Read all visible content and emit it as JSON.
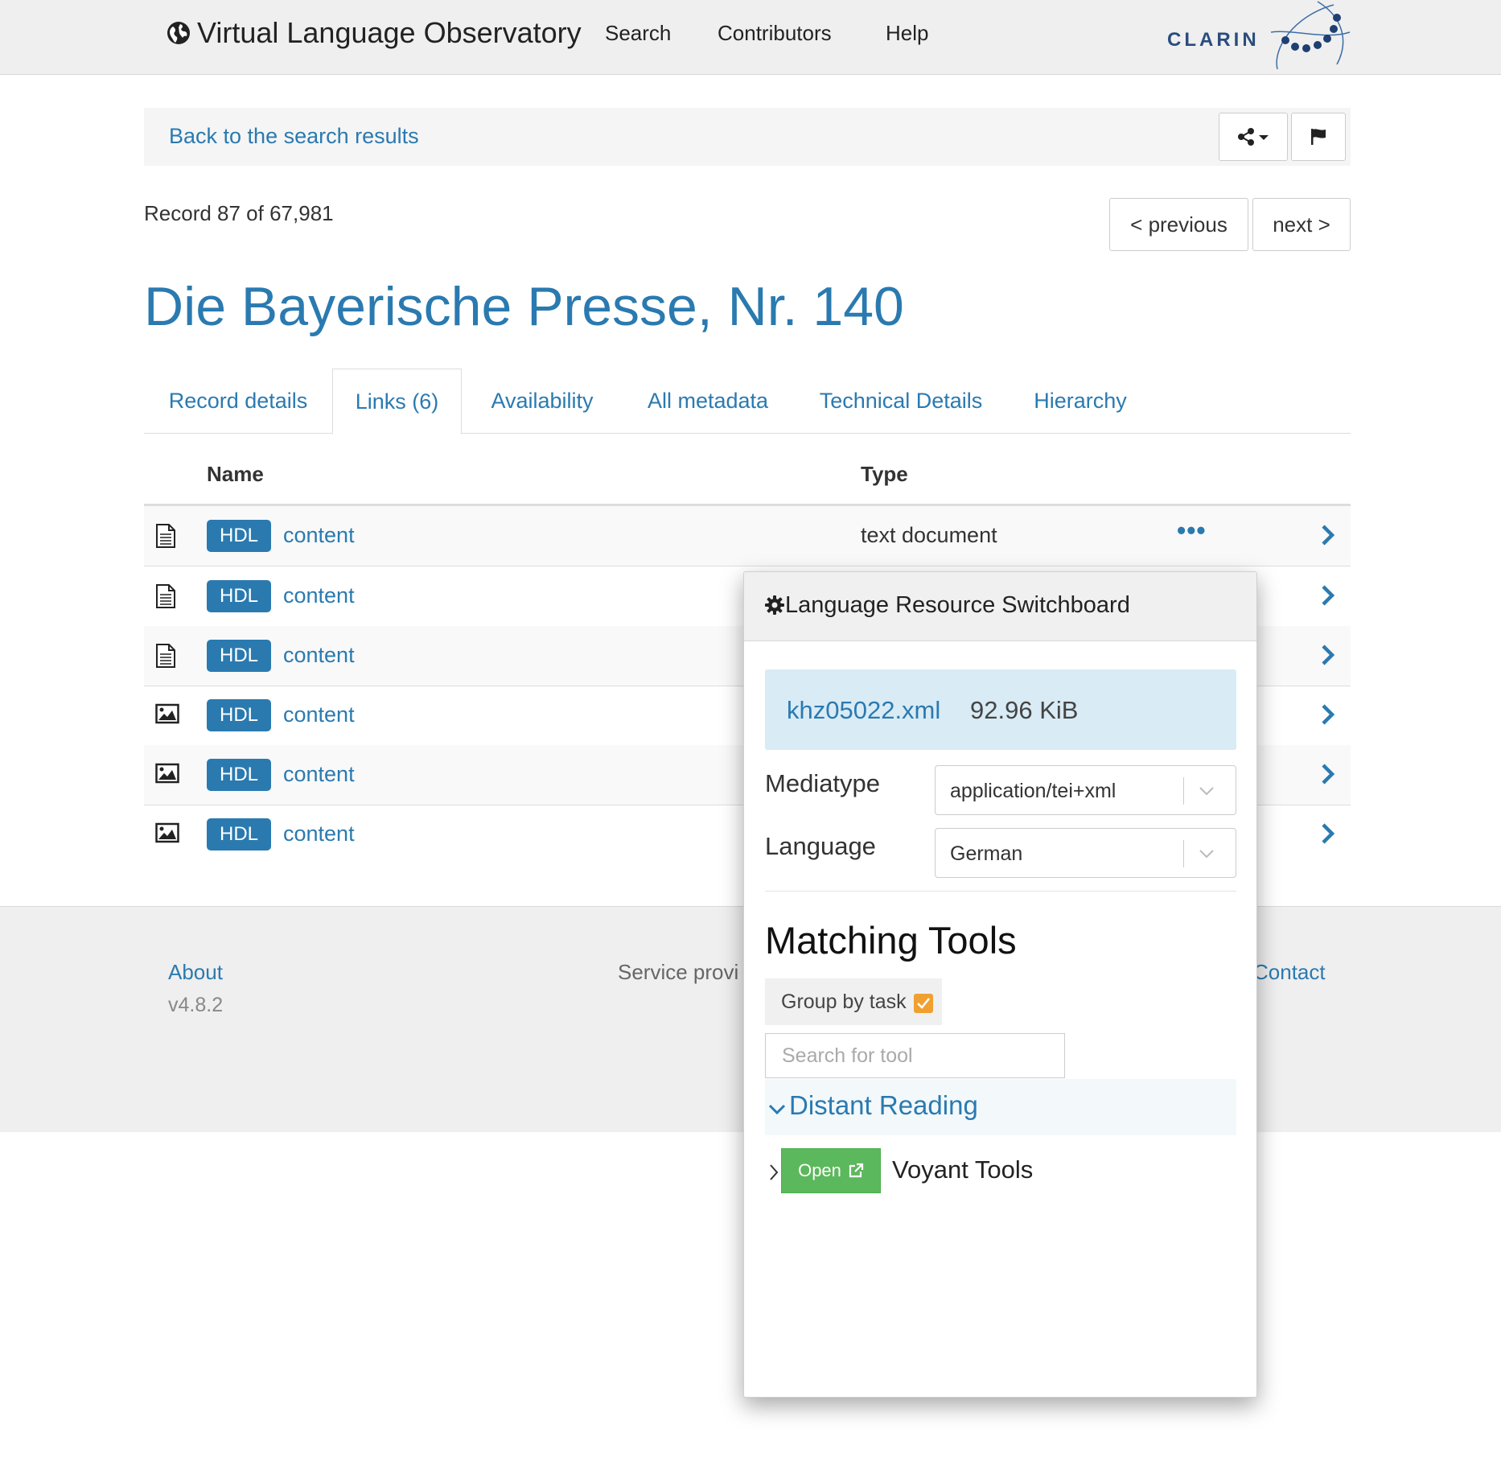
{
  "navbar": {
    "brand": "Virtual Language Observatory",
    "links": [
      "Search",
      "Contributors",
      "Help"
    ],
    "clarin": "CLARIN"
  },
  "backbar": {
    "back_label": "Back to the search results"
  },
  "record": {
    "count_text": "Record 87 of 67,981",
    "previous_label": "< previous",
    "next_label": "next >",
    "title": "Die Bayerische Presse, Nr. 140"
  },
  "tabs": [
    "Record details",
    "Links (6)",
    "Availability",
    "All metadata",
    "Technical Details",
    "Hierarchy"
  ],
  "table": {
    "headers": {
      "name": "Name",
      "type": "Type"
    },
    "rows": [
      {
        "icon": "document-icon",
        "badge": "HDL",
        "name": "content",
        "type": "text document"
      },
      {
        "icon": "document-icon",
        "badge": "HDL",
        "name": "content",
        "type": ""
      },
      {
        "icon": "document-icon",
        "badge": "HDL",
        "name": "content",
        "type": ""
      },
      {
        "icon": "image-icon",
        "badge": "HDL",
        "name": "content",
        "type": ""
      },
      {
        "icon": "image-icon",
        "badge": "HDL",
        "name": "content",
        "type": ""
      },
      {
        "icon": "image-icon",
        "badge": "HDL",
        "name": "content",
        "type": ""
      }
    ]
  },
  "footer": {
    "about": "About",
    "version": "v4.8.2",
    "service": "Service provi",
    "contact": "Contact"
  },
  "switchboard": {
    "title": "Language Resource Switchboard",
    "file_name": "khz05022.xml",
    "file_size": "92.96 KiB",
    "mediatype_label": "Mediatype",
    "mediatype_value": "application/tei+xml",
    "language_label": "Language",
    "language_value": "German",
    "matching_title": "Matching Tools",
    "group_label": "Group by task",
    "search_placeholder": "Search for tool",
    "category": "Distant Reading",
    "open_label": "Open",
    "tool_name": "Voyant Tools"
  },
  "colors": {
    "accent": "#2a7ab0",
    "success": "#5cb85c",
    "checkbox": "#f0a030"
  }
}
